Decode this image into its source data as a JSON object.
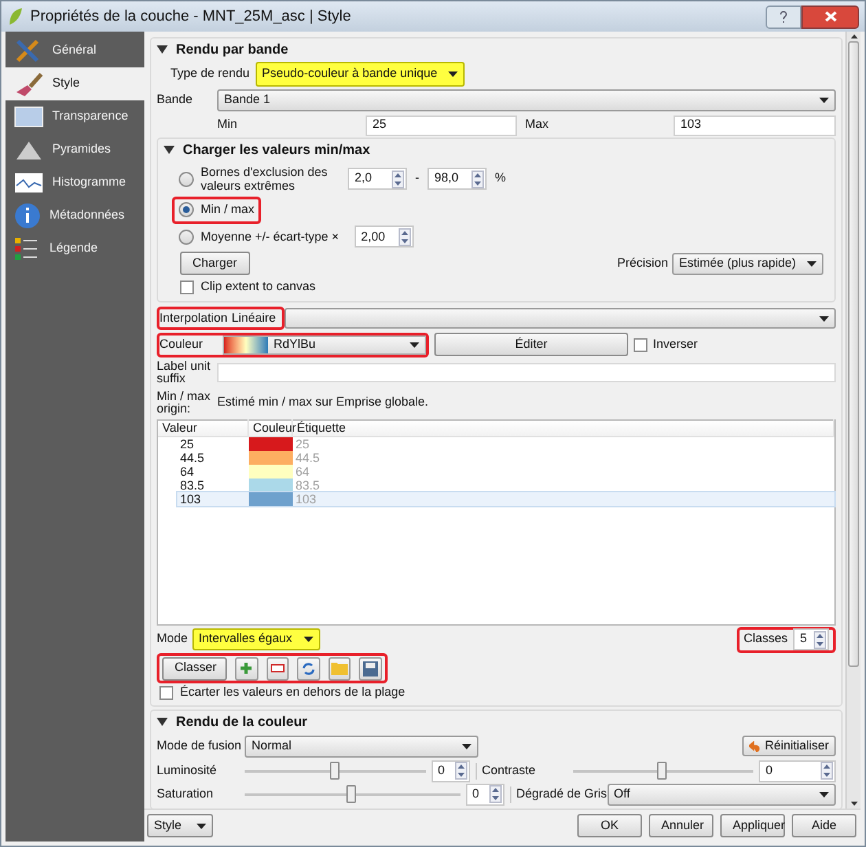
{
  "window": {
    "title": "Propriétés de la couche - MNT_25M_asc | Style"
  },
  "sidebar": {
    "items": [
      {
        "label": "Général",
        "selected": false
      },
      {
        "label": "Style",
        "selected": true
      },
      {
        "label": "Transparence",
        "selected": false
      },
      {
        "label": "Pyramides",
        "selected": false
      },
      {
        "label": "Histogramme",
        "selected": false
      },
      {
        "label": "Métadonnées",
        "selected": false
      },
      {
        "label": "Légende",
        "selected": false
      }
    ]
  },
  "band_rendering": {
    "title": "Rendu par bande",
    "render_type": {
      "label": "Type de rendu",
      "value": "Pseudo-couleur à bande unique",
      "highlighted": true
    },
    "band": {
      "label": "Bande",
      "value": "Bande 1"
    },
    "min": {
      "label": "Min",
      "value": "25"
    },
    "max": {
      "label": "Max",
      "value": "103"
    }
  },
  "load_minmax": {
    "title": "Charger les valeurs min/max",
    "options": [
      {
        "label": "Bornes d'exclusion des valeurs extrêmes",
        "selected": false,
        "circled": false,
        "fields": [
          "2,0",
          "98,0"
        ],
        "separator": "-",
        "unit": "%"
      },
      {
        "label": "Min / max",
        "selected": true,
        "circled": true
      },
      {
        "label": "Moyenne +/- écart-type ×",
        "selected": false,
        "circled": false,
        "fields": [
          "2,00"
        ]
      }
    ],
    "load_button": "Charger",
    "clip": {
      "label": "Clip extent to canvas",
      "checked": false
    },
    "precision": {
      "label": "Précision",
      "value": "Estimée (plus rapide)"
    }
  },
  "interpolation": {
    "label": "Interpolation",
    "value": "Linéaire",
    "circled": true
  },
  "color_ramp": {
    "label": "Couleur",
    "value": "RdYlBu",
    "circled": true,
    "edit_button": "Éditer",
    "invert": {
      "label": "Inverser",
      "checked": false
    }
  },
  "label_suffix": {
    "label": "Label unit suffix"
  },
  "origin": {
    "label": "Min / max origin:",
    "value": "Estimé min / max sur Emprise globale."
  },
  "table": {
    "columns": [
      "Valeur",
      "Couleur",
      "Étiquette"
    ],
    "rows": [
      {
        "value": "25",
        "color": "#d7191c",
        "label": "25",
        "selected": false
      },
      {
        "value": "44.5",
        "color": "#fdae61",
        "label": "44.5",
        "selected": false
      },
      {
        "value": "64",
        "color": "#ffffbf",
        "label": "64",
        "selected": false
      },
      {
        "value": "83.5",
        "color": "#abd9e9",
        "label": "83.5",
        "selected": false
      },
      {
        "value": "103",
        "color": "#6fa1cd",
        "label": "103",
        "selected": true
      }
    ]
  },
  "mode": {
    "label": "Mode",
    "value": "Intervalles égaux",
    "highlighted": true
  },
  "classes": {
    "label": "Classes",
    "value": "5",
    "circled": true
  },
  "toolbar": {
    "classify_button": "Classer",
    "circled": true
  },
  "clip_out": {
    "label": "Écarter les valeurs en dehors de la plage",
    "checked": false
  },
  "color_rendering": {
    "title": "Rendu de la couleur",
    "blend": {
      "label": "Mode de fusion",
      "value": "Normal"
    },
    "reset_button": "Réinitialiser",
    "brightness": {
      "label": "Luminosité",
      "level": 0.5,
      "value": "0"
    },
    "contrast": {
      "label": "Contraste",
      "level": 0.5,
      "value": "0"
    },
    "saturation": {
      "label": "Saturation",
      "level": 0.5,
      "value": "0"
    },
    "grayscale": {
      "label": "Dégradé de Gris",
      "value": "Off"
    }
  },
  "footer": {
    "style_button": "Style",
    "buttons": [
      "OK",
      "Annuler",
      "Appliquer",
      "Aide"
    ]
  }
}
